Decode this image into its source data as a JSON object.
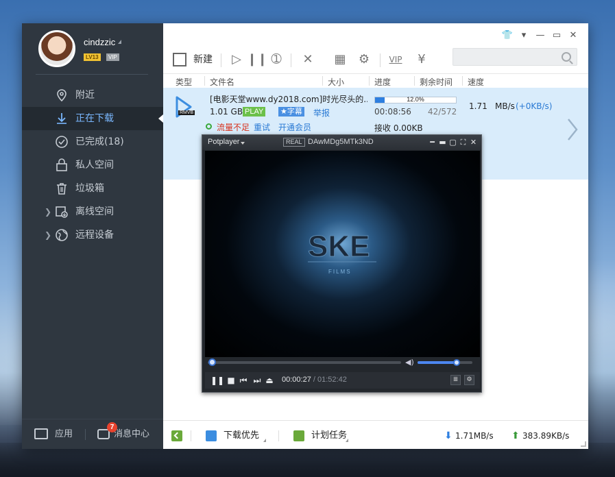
{
  "sidebar": {
    "username": "cindzzic",
    "level_badge": "LV13",
    "vip_badge": "VIP",
    "items": [
      {
        "label": "附近",
        "icon": "location-icon"
      },
      {
        "label": "正在下载",
        "icon": "download-icon",
        "active": true
      },
      {
        "label": "已完成(18)",
        "icon": "check-circle-icon"
      },
      {
        "label": "私人空间",
        "icon": "lock-icon"
      },
      {
        "label": "垃圾箱",
        "icon": "trash-icon"
      },
      {
        "label": "离线空间",
        "icon": "offline-download-icon"
      },
      {
        "label": "远程设备",
        "icon": "globe-icon"
      }
    ],
    "footer": {
      "apps_label": "应用",
      "messages_label": "消息中心",
      "messages_count": "7"
    }
  },
  "toolbar": {
    "new_label": "新建",
    "search_placeholder": ""
  },
  "columns": {
    "type": "类型",
    "filename": "文件名",
    "size": "大小",
    "progress": "进度",
    "remaining": "剩余时间",
    "speed": "速度"
  },
  "task": {
    "name": "[电影天堂www.dy2018.com]时光尽头的...",
    "file_type": "RMVB",
    "size": "1.01 GB",
    "play_label": "PLAY",
    "subtitle_label": "★字幕",
    "report_label": "举报",
    "warning": "流量不足",
    "retry_label": "重试",
    "member_label": "开通会员",
    "progress_text": "12.0%",
    "progress_value": 0.12,
    "elapsed": "00:08:56",
    "pieces": "42/572",
    "speed": "1.71",
    "speed_unit": "MB/s",
    "speed_extra": "(+0KB/s)",
    "received": "接收 0.00KB"
  },
  "statusbar": {
    "priority_label": "下载优先",
    "schedule_label": "计划任务",
    "download_rate": "1.71MB/s",
    "upload_rate": "383.89KB/s"
  },
  "player": {
    "app_name": "Potplayer",
    "real_badge": "REAL",
    "file_title": "DAwMDg5MTk3ND",
    "logo_text": "SKE",
    "logo_sub": "FILMS",
    "current_time": "00:00:27",
    "total_time": " / 01:52:42",
    "seek_value": 0.004,
    "volume_value": 0.72
  },
  "colors": {
    "sidebar_bg": "#2f3740",
    "accent_blue": "#2e7fe0",
    "row_highlight": "#d9ecfb",
    "warning_red": "#d8301b",
    "play_green": "#6cc04a"
  }
}
